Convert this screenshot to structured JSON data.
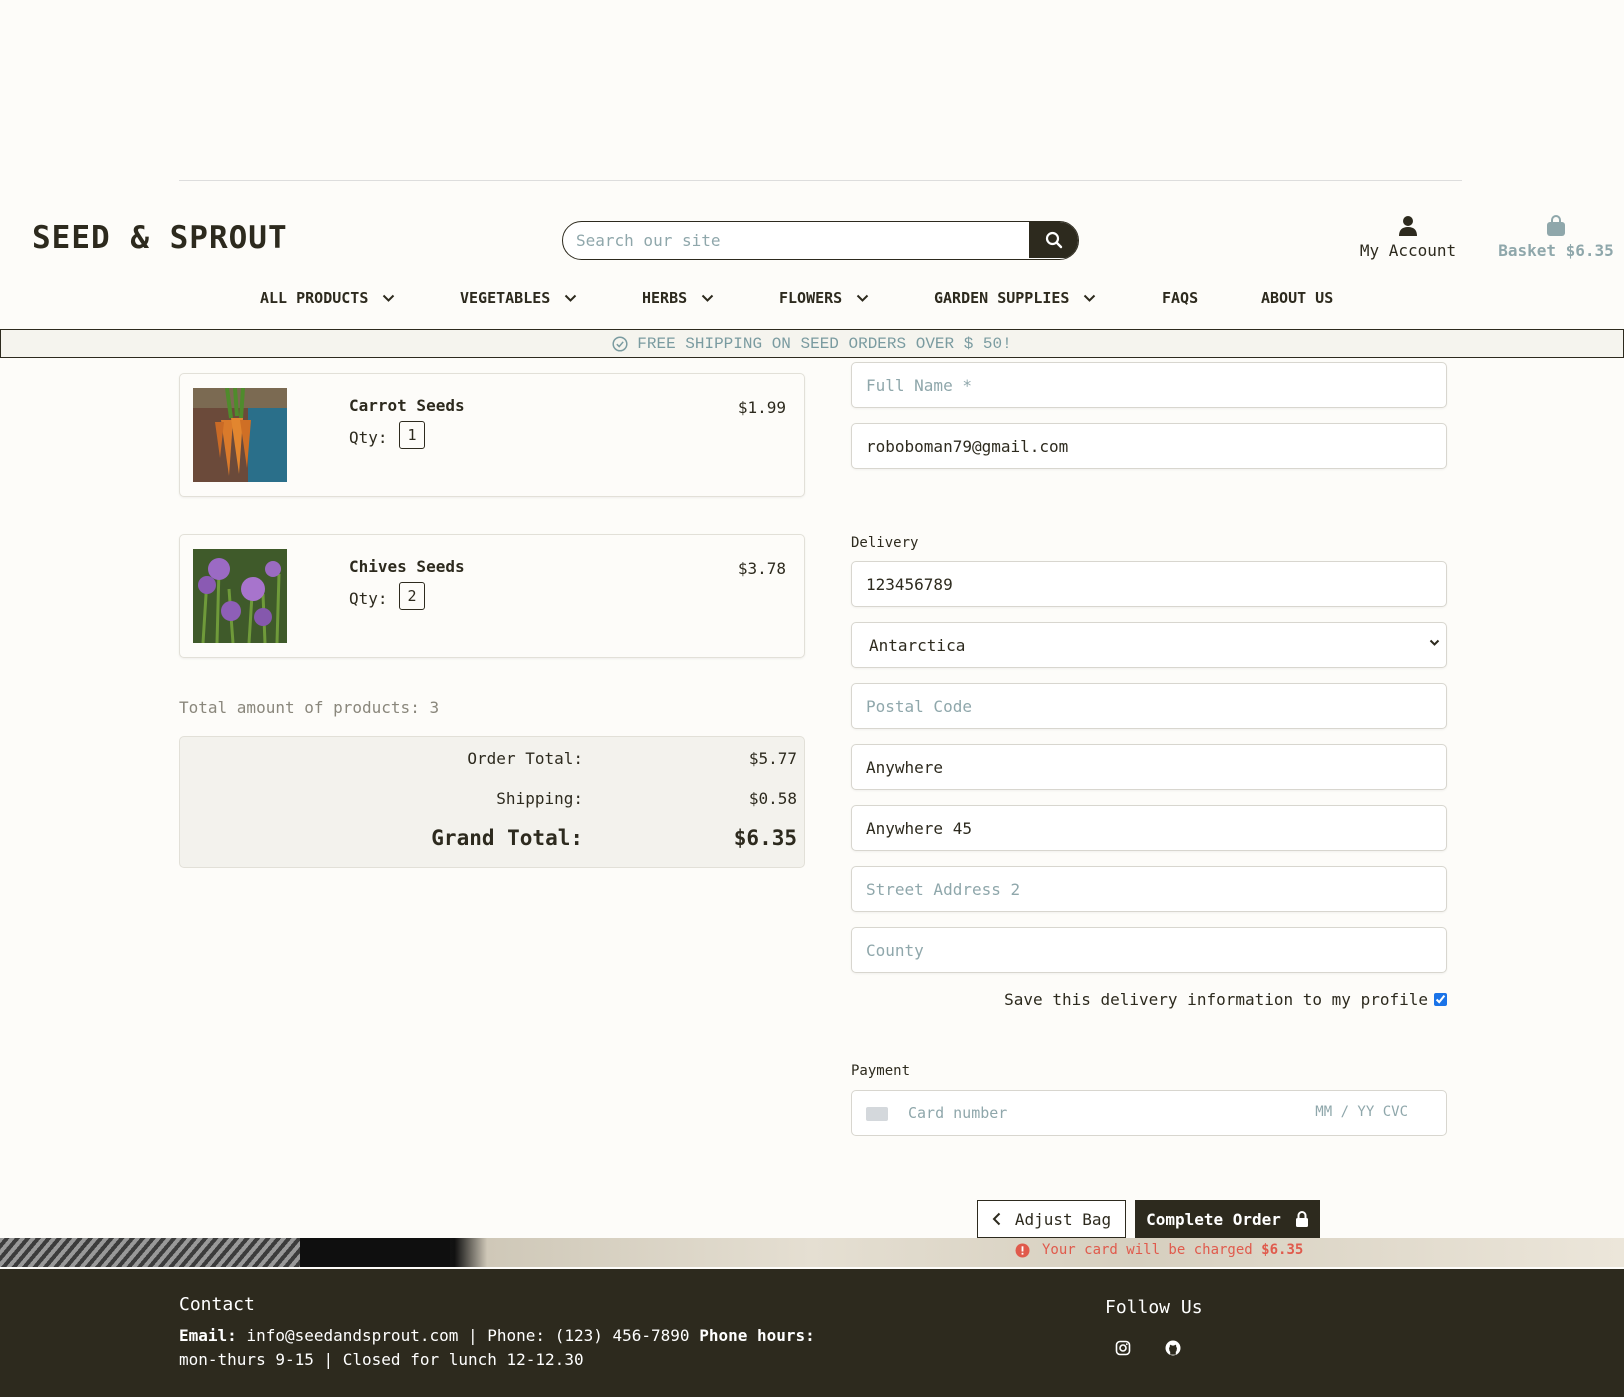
{
  "header": {
    "brand": "SEED & SPROUT",
    "search_placeholder": "Search our site",
    "account_label": "My Account",
    "basket_label": "Basket $6.35"
  },
  "nav": {
    "items": [
      {
        "label": "ALL PRODUCTS",
        "has_dropdown": true
      },
      {
        "label": "VEGETABLES",
        "has_dropdown": true
      },
      {
        "label": "HERBS",
        "has_dropdown": true
      },
      {
        "label": "FLOWERS",
        "has_dropdown": true
      },
      {
        "label": "GARDEN SUPPLIES",
        "has_dropdown": true
      },
      {
        "label": "FAQS",
        "has_dropdown": false
      },
      {
        "label": "ABOUT US",
        "has_dropdown": false
      }
    ]
  },
  "banner": {
    "text": "FREE SHIPPING ON SEED ORDERS OVER $ 50!"
  },
  "cart": {
    "products": [
      {
        "name": "Carrot Seeds",
        "qty_label": "Qty:",
        "qty": "1",
        "price": "$1.99"
      },
      {
        "name": "Chives Seeds",
        "qty_label": "Qty:",
        "qty": "2",
        "price": "$3.78"
      }
    ],
    "total_count": "Total amount of products: 3",
    "summary": {
      "order_total_label": "Order Total:",
      "order_total": "$5.77",
      "shipping_label": "Shipping:",
      "shipping": "$0.58",
      "grand_total_label": "Grand Total:",
      "grand_total": "$6.35"
    }
  },
  "form": {
    "full_name_placeholder": "Full Name *",
    "email_value": "roboboman79@gmail.com",
    "delivery_label": "Delivery",
    "phone_value": "123456789",
    "country_value": "Antarctica",
    "postal_placeholder": "Postal Code",
    "town_value": "Anywhere",
    "street1_value": "Anywhere 45",
    "street2_placeholder": "Street Address 2",
    "county_placeholder": "County",
    "save_label": "Save this delivery information to my profile",
    "save_checked": true,
    "payment_label": "Payment",
    "card_placeholder": "Card number",
    "card_exp_placeholder": "MM / YY CVC"
  },
  "actions": {
    "adjust_label": "Adjust Bag",
    "complete_label": "Complete Order",
    "charge_warning_prefix": "Your card will be charged",
    "charge_amount": "$6.35"
  },
  "footer": {
    "contact_title": "Contact",
    "email_label": "Email:",
    "email_value": "info@seedandsprout.com | Phone: (123) 456-7890",
    "hours_label": "Phone hours:",
    "hours_value": "mon-thurs 9-15 | Closed for lunch 12-12.30",
    "follow_title": "Follow Us",
    "social_icons": [
      "instagram-icon",
      "github-icon"
    ]
  },
  "colors": {
    "dark": "#2d2a1e",
    "muted_teal": "#8fa7ab",
    "error": "#e05a4c",
    "page_bg": "#fdfcf9"
  }
}
